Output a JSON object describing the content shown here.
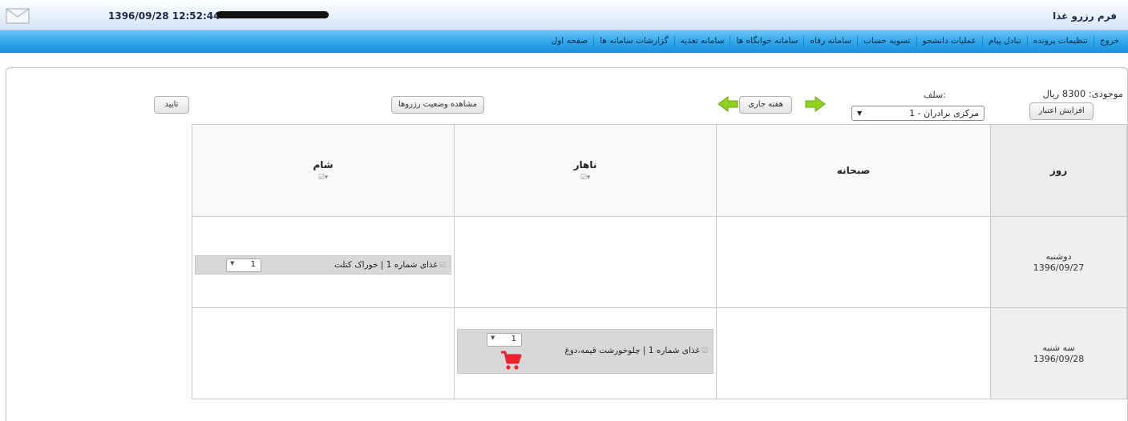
{
  "header": {
    "datetime": "1396/09/28 12:52:44",
    "title": "فرم رزرو غذا"
  },
  "menu": [
    "صفحه اول",
    "گزارشات سامانه ها",
    "سامانه تغذیه",
    "سامانه خوابگاه ها",
    "سامانه رفاه",
    "تسویه حساب",
    "عملیات دانشجو",
    "تبادل پیام",
    "تنظیمات پرونده",
    "خروج"
  ],
  "controls": {
    "balance_label": "موجودی:",
    "balance_value": "8300 ریال",
    "increase_credit": "افزایش اعتبار",
    "self_label": "سلف:",
    "self_selected": "مرکزی برادران - 1",
    "current_week": "هفته جاری",
    "view_status": "مشاهده وضعیت رزروها",
    "confirm": "تایید"
  },
  "table": {
    "headers": {
      "day": "روز",
      "breakfast": "صبحانه",
      "lunch": "ناهار",
      "dinner": "شام"
    },
    "rows": [
      {
        "day_name": "دوشنبه",
        "date": "1396/09/27",
        "dinner": {
          "text": "غذای شماره 1 | خوراک کتلت",
          "qty": "1"
        }
      },
      {
        "day_name": "سه شنبه",
        "date": "1396/09/28",
        "lunch": {
          "text": "غذای شماره 1 | چلوخورشت قیمه،دوغ",
          "qty": "1"
        }
      }
    ]
  },
  "icons": {
    "mail": "mail-icon",
    "arrows": [
      "arrow-left-icon",
      "arrow-right-icon"
    ],
    "cart": "shopping-cart-icon"
  },
  "colors": {
    "menubar": "#2fa6ea",
    "arrow": "#8fd21f",
    "cart": "#e8252f",
    "item_bg": "#d8d8d8"
  }
}
